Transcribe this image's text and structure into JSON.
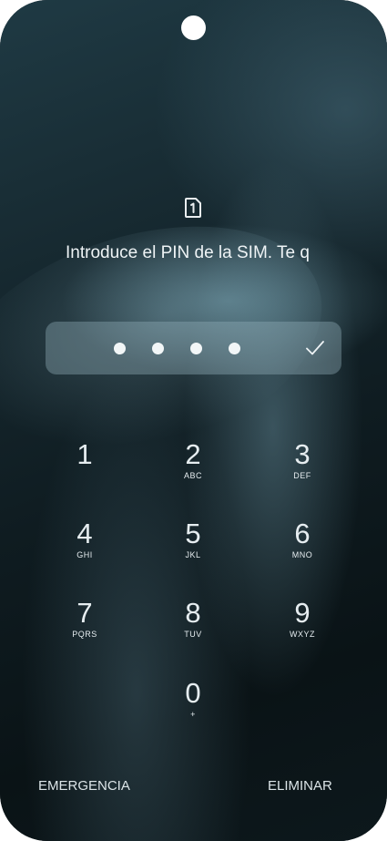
{
  "sim_prompt": "Introduce el PIN de la SIM. Te q",
  "pin": {
    "entered_digits": 4
  },
  "keypad": [
    {
      "num": "1",
      "letters": ""
    },
    {
      "num": "2",
      "letters": "ABC"
    },
    {
      "num": "3",
      "letters": "DEF"
    },
    {
      "num": "4",
      "letters": "GHI"
    },
    {
      "num": "5",
      "letters": "JKL"
    },
    {
      "num": "6",
      "letters": "MNO"
    },
    {
      "num": "7",
      "letters": "PQRS"
    },
    {
      "num": "8",
      "letters": "TUV"
    },
    {
      "num": "9",
      "letters": "WXYZ"
    },
    {
      "num": "0",
      "letters": "+"
    }
  ],
  "actions": {
    "emergency_label": "EMERGENCIA",
    "delete_label": "ELIMINAR"
  },
  "icons": {
    "sim": "sim-card-icon",
    "confirm": "checkmark-icon"
  }
}
